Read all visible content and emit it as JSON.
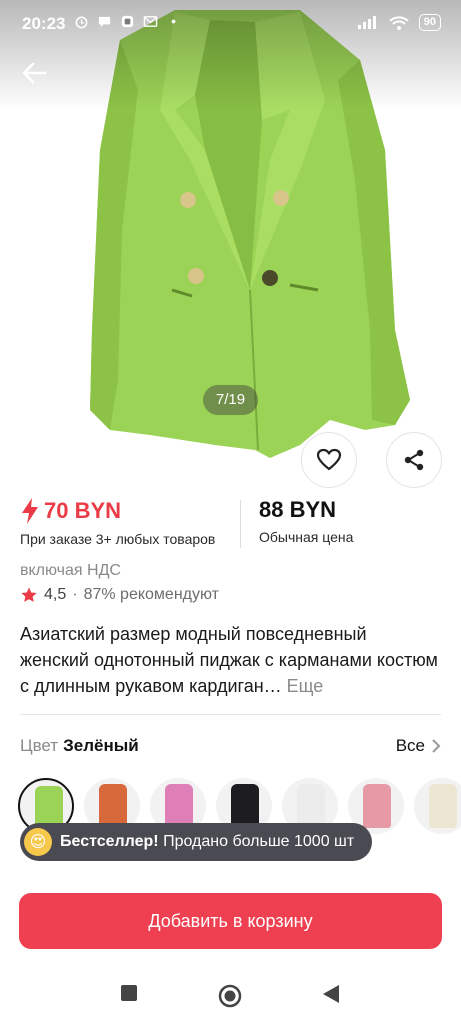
{
  "status_bar": {
    "time": "20:23",
    "battery": "90"
  },
  "gallery": {
    "counter": "7/19",
    "icons": [
      "back-arrow-icon",
      "heart-icon",
      "share-icon"
    ]
  },
  "price": {
    "sale_price": "70 BYN",
    "sale_note": "При заказе 3+ любых товаров",
    "regular_price": "88 BYN",
    "regular_note": "Обычная цена",
    "accent_color": "#ea3b46"
  },
  "vat": "включая НДС",
  "rating": {
    "value": "4,5",
    "separator": "·",
    "recommend": "87% рекомендуют"
  },
  "product": {
    "title": "Азиатский размер модный повседневный женский однотонный пиджак с карманами костюм с длинным рукавом кардиган…",
    "more": "Еще"
  },
  "color_selector": {
    "label": "Цвет",
    "selected": "Зелёный",
    "all": "Все",
    "swatches": [
      {
        "name": "green",
        "color": "#9bd356"
      },
      {
        "name": "orange",
        "color": "#d8693a"
      },
      {
        "name": "pink",
        "color": "#de7fb8"
      },
      {
        "name": "black",
        "color": "#1d1d1f"
      },
      {
        "name": "white",
        "color": "#ececec"
      },
      {
        "name": "rose",
        "color": "#e59aa6"
      },
      {
        "name": "beige",
        "color": "#ece6d3"
      }
    ]
  },
  "badge": {
    "emoji": "😍",
    "strong": "Бестселлер!",
    "text": "Продано больше 1000 шт"
  },
  "cart_button": "Добавить в корзину",
  "nav": {
    "icons": [
      "recents-square-icon",
      "home-circle-icon",
      "back-triangle-icon"
    ]
  }
}
